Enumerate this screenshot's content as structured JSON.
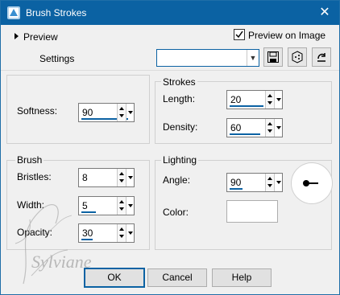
{
  "window": {
    "title": "Brush Strokes",
    "close_glyph": "✕"
  },
  "header": {
    "preview_label": "Preview",
    "preview_on_image_label": "Preview on Image",
    "preview_on_image_checked": true,
    "settings_label": "Settings",
    "settings_value": ""
  },
  "toolbar": {
    "icons": [
      "save-preset-icon",
      "randomize-dice-icon",
      "reset-defaults-icon"
    ]
  },
  "left": {
    "softness": {
      "label": "Softness:",
      "value": "90",
      "level": 90
    },
    "brush_group_label": "Brush",
    "bristles": {
      "label": "Bristles:",
      "value": "8"
    },
    "width": {
      "label": "Width:",
      "value": "5"
    },
    "opacity": {
      "label": "Opacity:",
      "value": "30"
    }
  },
  "right": {
    "strokes_group_label": "Strokes",
    "length": {
      "label": "Length:",
      "value": "20"
    },
    "density": {
      "label": "Density:",
      "value": "60"
    },
    "lighting_group_label": "Lighting",
    "angle": {
      "label": "Angle:",
      "value": "90"
    },
    "color": {
      "label": "Color:",
      "swatch": "#ffffff"
    }
  },
  "buttons": {
    "ok": "OK",
    "cancel": "Cancel",
    "help": "Help"
  },
  "watermark_text": "Sylviane",
  "colors": {
    "accent": "#0b62a3",
    "titlebar": "#0b62a3",
    "dialog_bg": "#f0f0f0"
  }
}
